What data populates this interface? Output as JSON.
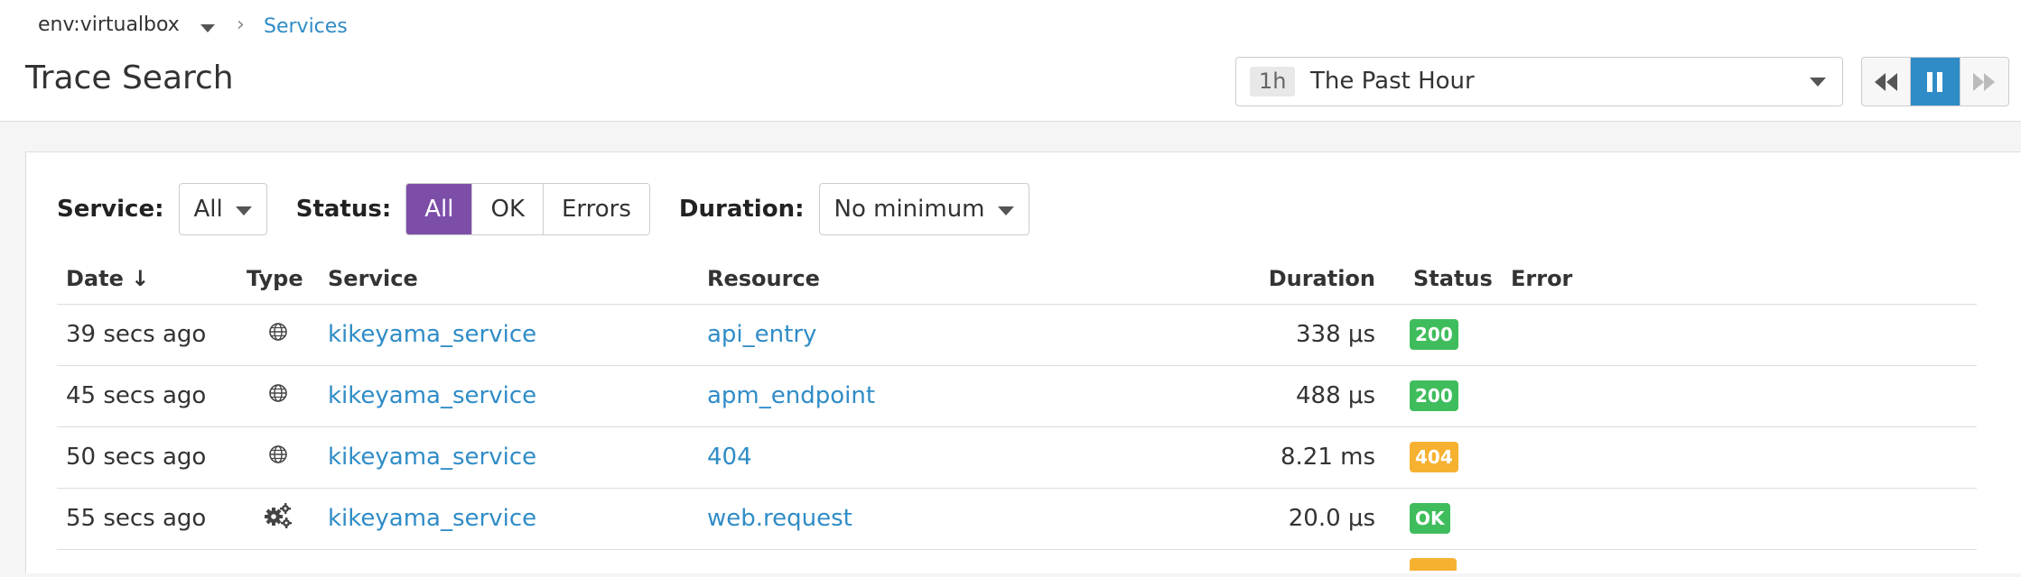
{
  "breadcrumb": {
    "env": "env:virtualbox",
    "separator": ">",
    "link": "Services"
  },
  "header": {
    "title": "Trace Search"
  },
  "time_range": {
    "badge": "1h",
    "label": "The Past Hour"
  },
  "playback": {
    "buttons": [
      "rewind-icon",
      "pause-icon",
      "fast-forward-icon"
    ],
    "active": "pause"
  },
  "filters": {
    "service_label": "Service:",
    "service_value": "All",
    "status_label": "Status:",
    "status_options": [
      "All",
      "OK",
      "Errors"
    ],
    "status_selected": "All",
    "duration_label": "Duration:",
    "duration_value": "No minimum"
  },
  "table": {
    "columns": [
      "Date ↓",
      "Type",
      "Service",
      "Resource",
      "Duration",
      "Status",
      "Error"
    ],
    "rows": [
      {
        "date": "39 secs ago",
        "type": "globe-icon",
        "service": "kikeyama_service",
        "resource": "api_entry",
        "duration": "338 μs",
        "status": "200",
        "status_color": "#3fbd5c",
        "error": ""
      },
      {
        "date": "45 secs ago",
        "type": "globe-icon",
        "service": "kikeyama_service",
        "resource": "apm_endpoint",
        "duration": "488 μs",
        "status": "200",
        "status_color": "#3fbd5c",
        "error": ""
      },
      {
        "date": "50 secs ago",
        "type": "globe-icon",
        "service": "kikeyama_service",
        "resource": "404",
        "duration": "8.21 ms",
        "status": "404",
        "status_color": "#f7b131",
        "error": ""
      },
      {
        "date": "55 secs ago",
        "type": "gears-icon",
        "service": "kikeyama_service",
        "resource": "web.request",
        "duration": "20.0 μs",
        "status": "OK",
        "status_color": "#3fbd5c",
        "error": ""
      }
    ]
  },
  "colors": {
    "accent": "#7c4ea8",
    "link": "#2f8cc7",
    "ok": "#3fbd5c",
    "warn": "#f7b131"
  }
}
